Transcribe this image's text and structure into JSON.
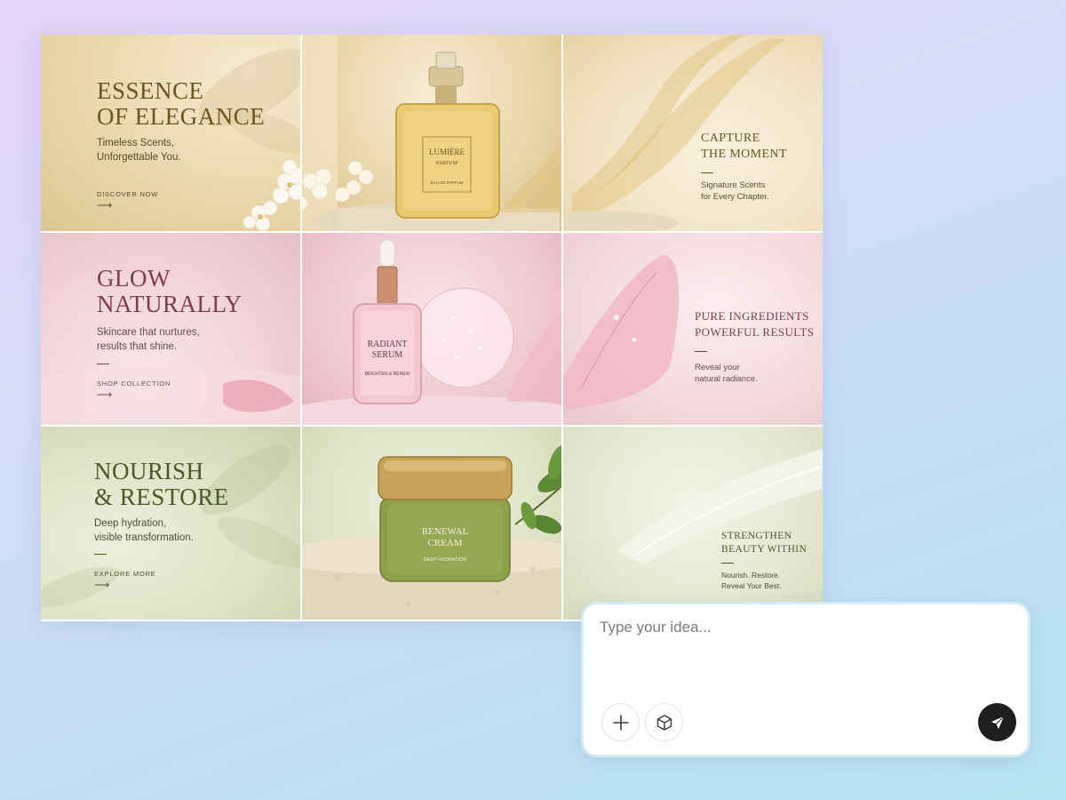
{
  "collage": {
    "row1": {
      "left": {
        "headline": "ESSENCE\nOF ELEGANCE",
        "subline": "Timeless Scents,\nUnforgettable You.",
        "cta": "DISCOVER NOW"
      },
      "center": {
        "bottle_name": "LUMIÈRE",
        "bottle_type": "PARFUM",
        "bottle_sub": "EAU DE PARFUM"
      },
      "right": {
        "headline": "CAPTURE\nTHE MOMENT",
        "subline": "Signature Scents\nfor Every Chapter."
      }
    },
    "row2": {
      "left": {
        "headline": "GLOW\nNATURALLY",
        "subline": "Skincare that nurtures,\nresults that shine.",
        "cta": "SHOP COLLECTION"
      },
      "center": {
        "bottle_name": "RADIANT\nSERUM",
        "bottle_sub": "BRIGHTEN & RENEW"
      },
      "right": {
        "headline": "PURE INGREDIENTS\nPOWERFUL RESULTS",
        "subline": "Reveal your\nnatural radiance."
      }
    },
    "row3": {
      "left": {
        "headline": "NOURISH\n& RESTORE",
        "subline": "Deep hydration,\nvisible transformation.",
        "cta": "EXPLORE MORE"
      },
      "center": {
        "jar_name": "RENEWAL\nCREAM",
        "jar_sub": "DEEP HYDRATION"
      },
      "right": {
        "headline": "STRENGTHEN\nBEAUTY WITHIN",
        "subline": "Nourish. Restore.\nReveal Your Best."
      }
    }
  },
  "chat": {
    "placeholder": "Type your idea...",
    "value": "",
    "buttons": {
      "add": "plus-icon",
      "model": "cube-icon",
      "send": "send-icon"
    }
  },
  "colors": {
    "gold_text": "#6e5420",
    "pink_text": "#7e4048",
    "green_text": "#4d5828",
    "send_button": "#1e1e1e"
  }
}
